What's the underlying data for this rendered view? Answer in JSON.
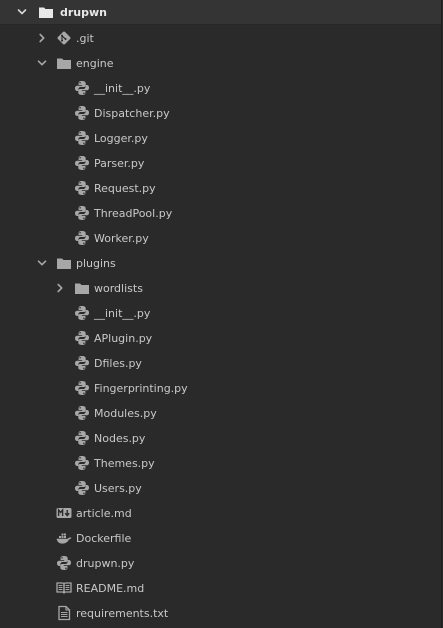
{
  "tree": {
    "root": {
      "label": "drupwn",
      "icon": "folder-icon",
      "expanded": true
    },
    "items": [
      {
        "id": "git",
        "label": ".git",
        "icon": "git-icon",
        "chevron": "chevron-right-icon"
      },
      {
        "id": "engine",
        "label": "engine",
        "icon": "folder-icon",
        "chevron": "chevron-down-icon"
      },
      {
        "id": "engine-init",
        "label": "__init__.py",
        "icon": "python-icon"
      },
      {
        "id": "engine-dispatcher",
        "label": "Dispatcher.py",
        "icon": "python-icon"
      },
      {
        "id": "engine-logger",
        "label": "Logger.py",
        "icon": "python-icon"
      },
      {
        "id": "engine-parser",
        "label": "Parser.py",
        "icon": "python-icon"
      },
      {
        "id": "engine-request",
        "label": "Request.py",
        "icon": "python-icon"
      },
      {
        "id": "engine-threadpool",
        "label": "ThreadPool.py",
        "icon": "python-icon"
      },
      {
        "id": "engine-worker",
        "label": "Worker.py",
        "icon": "python-icon"
      },
      {
        "id": "plugins",
        "label": "plugins",
        "icon": "folder-icon",
        "chevron": "chevron-down-icon"
      },
      {
        "id": "wordlists",
        "label": "wordlists",
        "icon": "folder-icon",
        "chevron": "chevron-right-icon"
      },
      {
        "id": "plugins-init",
        "label": "__init__.py",
        "icon": "python-icon"
      },
      {
        "id": "plugins-aplugin",
        "label": "APlugin.py",
        "icon": "python-icon"
      },
      {
        "id": "plugins-dfiles",
        "label": "Dfiles.py",
        "icon": "python-icon"
      },
      {
        "id": "plugins-fingerprinting",
        "label": "Fingerprinting.py",
        "icon": "python-icon"
      },
      {
        "id": "plugins-modules",
        "label": "Modules.py",
        "icon": "python-icon"
      },
      {
        "id": "plugins-nodes",
        "label": "Nodes.py",
        "icon": "python-icon"
      },
      {
        "id": "plugins-themes",
        "label": "Themes.py",
        "icon": "python-icon"
      },
      {
        "id": "plugins-users",
        "label": "Users.py",
        "icon": "python-icon"
      },
      {
        "id": "article-md",
        "label": "article.md",
        "icon": "markdown-icon"
      },
      {
        "id": "dockerfile",
        "label": "Dockerfile",
        "icon": "docker-icon"
      },
      {
        "id": "drupwn-py",
        "label": "drupwn.py",
        "icon": "python-icon"
      },
      {
        "id": "readme-md",
        "label": "README.md",
        "icon": "readme-icon"
      },
      {
        "id": "requirements-txt",
        "label": "requirements.txt",
        "icon": "text-file-icon"
      }
    ]
  },
  "colors": {
    "background": "#2a2a2a",
    "root_row": "#343434",
    "text": "#c9c9c9",
    "icon": "#a7a7a7"
  }
}
